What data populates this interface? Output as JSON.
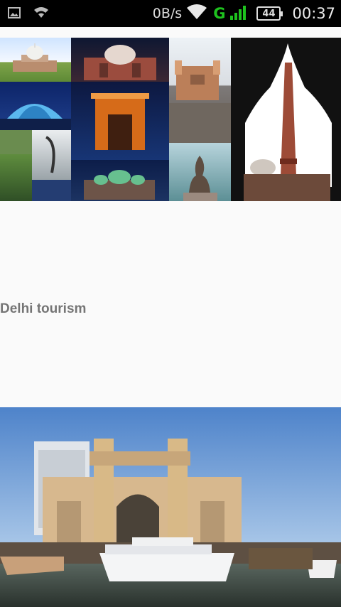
{
  "status_bar": {
    "net_speed": "0B/s",
    "network_type": "G",
    "battery_level": "44",
    "time": "00:37",
    "icons": [
      "image-icon",
      "cast-icon",
      "wifi-icon",
      "signal-icon",
      "battery-icon"
    ]
  },
  "gallery": {
    "collage_images": [
      "humayun-tomb",
      "india-gate-domed-building",
      "lotus-temple",
      "india-gate-night",
      "heritage-building",
      "qutub-minar",
      "garden-fountains",
      "sculpture",
      "mosque-night",
      "statue"
    ],
    "title": "Delhi tourism",
    "next_image": "gateway-of-india"
  },
  "colors": {
    "status_bar_bg": "#000000",
    "page_bg": "#fafafa",
    "title_text": "#757575",
    "network_green": "#1ec21e"
  }
}
